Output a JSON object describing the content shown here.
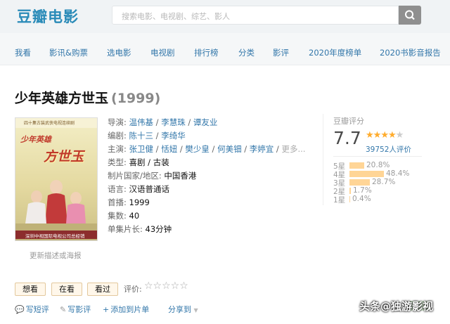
{
  "header": {
    "logo": "豆瓣电影",
    "search_placeholder": "搜索电影、电视剧、综艺、影人"
  },
  "nav": [
    "我看",
    "影讯&购票",
    "选电影",
    "电视剧",
    "排行榜",
    "分类",
    "影评",
    "2020年度榜单",
    "2020书影音报告"
  ],
  "movie": {
    "title": "少年英雄方世玉",
    "year": "(1999)",
    "poster": {
      "top_caption": "四十集古装武侠电视连续剧",
      "calligraphy_small": "少年英雄",
      "calligraphy_big": "方世玉",
      "bottom_caption": "深圳中视国际电视公司总经销"
    },
    "update_link": "更新描述或海报",
    "info": {
      "director_label": "导演:",
      "directors": [
        "温伟基",
        "李慧珠",
        "谭友业"
      ],
      "writer_label": "编剧:",
      "writers": [
        "陈十三",
        "李绮华"
      ],
      "cast_label": "主演:",
      "cast": [
        "张卫健",
        "恬妞",
        "樊少皇",
        "何美钿",
        "李婷宜"
      ],
      "cast_more": "更多...",
      "sep": " / ",
      "genre_label": "类型:",
      "genre": "喜剧 / 古装",
      "country_label": "制片国家/地区:",
      "country": "中国香港",
      "language_label": "语言:",
      "language": "汉语普通话",
      "premiere_label": "首播:",
      "premiere": "1999",
      "episodes_label": "集数:",
      "episodes": "40",
      "runtime_label": "单集片长:",
      "runtime": "43分钟"
    }
  },
  "rating": {
    "label": "豆瓣评分",
    "score": "7.7",
    "stars_filled": 4,
    "stars_total": 5,
    "count": "39752人评价",
    "breakdown": [
      {
        "label": "5星",
        "percent": "20.8%",
        "value": 20.8
      },
      {
        "label": "4星",
        "percent": "48.4%",
        "value": 48.4
      },
      {
        "label": "3星",
        "percent": "28.7%",
        "value": 28.7
      },
      {
        "label": "2星",
        "percent": "1.7%",
        "value": 1.7
      },
      {
        "label": "1星",
        "percent": "0.4%",
        "value": 0.4
      }
    ]
  },
  "actions": {
    "want": "想看",
    "watching": "在看",
    "watched": "看过",
    "rate_label": "评价:",
    "rate_stars": "☆☆☆☆☆"
  },
  "bottom": {
    "write_short": "写短评",
    "write_review": "写影评",
    "add_list": "添加到片单",
    "share": "分享到"
  },
  "watermark": "头条@独游影视",
  "colors": {
    "link": "#3377aa",
    "star": "#ffac2d",
    "bar": "#ffd596",
    "logo": "#2a8bb8"
  }
}
